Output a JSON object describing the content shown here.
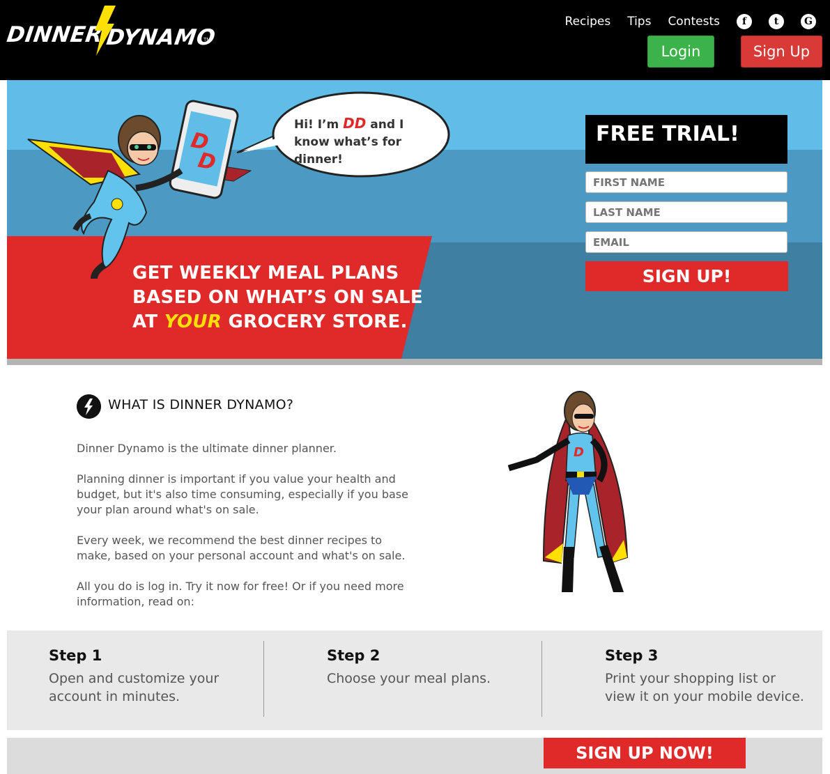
{
  "logo": {
    "word1": "DINNER",
    "word2": "DYNAMO",
    "tm": "TM"
  },
  "nav": {
    "recipes": "Recipes",
    "tips": "Tips",
    "contests": "Contests",
    "login": "Login",
    "signup": "Sign Up"
  },
  "social": {
    "facebook": "f",
    "twitter": "t",
    "google": "G"
  },
  "hero": {
    "bubble_pre": "Hi! I’m ",
    "bubble_dd": "DD",
    "bubble_post": " and I know what’s for dinner!",
    "tagline_line1": "GET WEEKLY MEAL PLANS",
    "tagline_line2": "BASED ON WHAT’S ON SALE",
    "tagline_at": "AT ",
    "tagline_your": "YOUR",
    "tagline_end": " GROCERY STORE.",
    "emblem": "DD"
  },
  "trial": {
    "title": "FREE TRIAL!",
    "first_placeholder": "FIRST NAME",
    "last_placeholder": "LAST NAME",
    "email_placeholder": "EMAIL",
    "button": "SIGN UP!"
  },
  "what": {
    "title": "WHAT IS DINNER DYNAMO?",
    "p1": "Dinner Dynamo is the ultimate dinner planner.",
    "p2": "Planning dinner is important if you value your health and budget, but it's also time consuming, especially if you base your plan around what's on sale.",
    "p3": "Every week, we recommend the best dinner recipes to make, based on your personal account and what's on sale.",
    "p4": "All you do is log in.  Try it now for free!  Or if you need more information, read on:"
  },
  "steps": [
    {
      "title": "Step 1",
      "desc": "Open and customize your account in minutes."
    },
    {
      "title": "Step 2",
      "desc": "Choose your meal plans."
    },
    {
      "title": "Step 3",
      "desc": "Print your shopping list or view it on your mobile device."
    }
  ],
  "cta": {
    "signup_now": "SIGN UP NOW!"
  },
  "colors": {
    "header": "#000000",
    "sky": "#5fbde8",
    "red": "#e02a2a",
    "green": "#3cb34a",
    "yellow": "#ffe000"
  }
}
